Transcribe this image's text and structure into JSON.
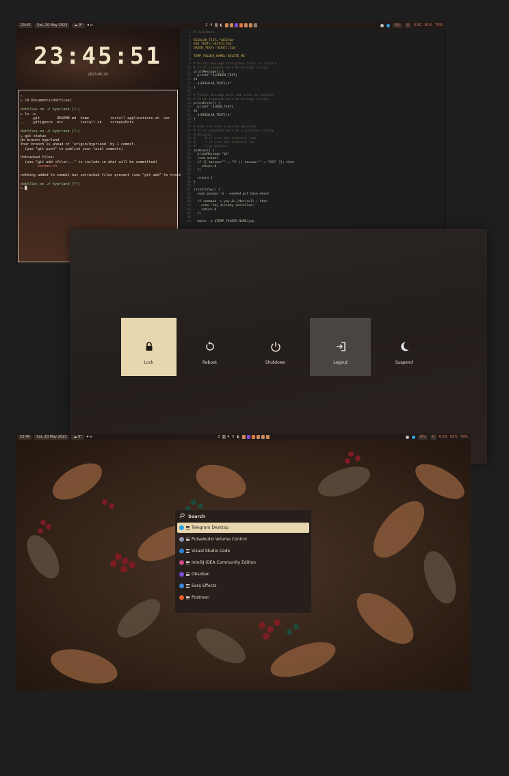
{
  "shot1": {
    "topbar": {
      "time": "23:45",
      "date": "Sat, 20 May 2023",
      "weather": "☁ 9°",
      "workspaces": [
        "2",
        "4",
        "5"
      ],
      "tray": [
        "0%",
        "0",
        "6.5G",
        "81%",
        "79%"
      ]
    },
    "clock": {
      "time": "23:45:51",
      "date": "2023-05-20"
    },
    "terminal": {
      "lines": [
        "~",
        "↳ cd Documents/dotfiles/",
        "",
        "dotfiles on ⎇ hyprland [?⇡]",
        "↳ ls -a",
        ".    .git        README.md  home          install_applications.sh  usr",
        "..   .gitignore  etc        install.sh    screenshots",
        "",
        "dotfiles on ⎇ hyprland [?⇡]",
        "↳ git status",
        "On branch hyprland",
        "Your branch is ahead of 'origin/hyprland' by 1 commit.",
        "  (use \"git push\" to publish your local commits)",
        "",
        "Untracked files:",
        "  (use \"git add <file>...\" to include in what will be committed)",
        "        screen.sh",
        "",
        "nothing added to commit but untracked files present (use \"git add\" to track)",
        "",
        "dotfiles on ⎇ hyprland [?⇡]",
        "↳ █"
      ]
    },
    "code": {
      "lines": [
        "#!/bin/bash",
        "",
        "REGULAR_TEXT='\\033[0m'",
        "RED_TEXT='\\033[1;31m'",
        "GREEN_TEXT='\\033[1;32m'",
        "",
        "TEMP_FOLDER_NAME='DELETE_ME'",
        "",
        "# Prints message with green color in console.",
        "# First argument must be message string.",
        "printMessage() {",
        "  printf \"${GREEN_TEXT}",
        "$1",
        "  ${REGULAR_TEXT}\\n\"",
        "}",
        "",
        "# Prints message with red color in console.",
        "# First argument must be message string.",
        "printError() {",
        "  printf \"${RED_TEXT}",
        "$1",
        "  ${REGULAR_TEXT}\\n\"",
        "}",
        "",
        "# Asks the user a yes/no question.",
        "# First argument must be a question string.",
        "# Returns:",
        "#   - 0 if user has selected 'yes'",
        "#   - 1 if user has selected 'no'",
        "#   - 1 by default",
        "askUser() {",
        "  printMessage \"$1\"",
        "  read answer",
        "  if [[ $answer\"\" = \"Y\" || $answer\"\" = \"YES\" ]]; then",
        "    return 0",
        "  fi",
        "",
        "  return 1",
        "}",
        "",
        "installYay() {",
        "  sudo pacman -S --needed git base-devel",
        "",
        "  if command -v yay &> /dev/null ; then",
        "    echo 'Yay already installed.'",
        "    return 0",
        "  fi",
        "",
        "  mkdir -p $TEMP_FOLDER_NAME/yay"
      ]
    }
  },
  "shot2": {
    "buttons": [
      {
        "label": "Lock",
        "icon": "lock-icon"
      },
      {
        "label": "Reboot",
        "icon": "reboot-icon"
      },
      {
        "label": "Shutdown",
        "icon": "power-icon"
      },
      {
        "label": "Logout",
        "icon": "logout-icon"
      },
      {
        "label": "Suspend",
        "icon": "moon-icon"
      }
    ],
    "colors": {
      "selected": "#e8d7ae",
      "hover": "#4a4442"
    }
  },
  "shot3": {
    "topbar": {
      "time": "23:46",
      "date": "Sat, 20 May 2023",
      "weather": "☁ 9°",
      "workspaces": [
        "2",
        "4",
        "5"
      ],
      "tray": [
        "0%",
        "0",
        "6.5G",
        "81%",
        "79%"
      ]
    },
    "launcher": {
      "search_label": "Search",
      "items": [
        {
          "name": "Telegram Desktop",
          "color": "#2aa3e0"
        },
        {
          "name": "PulseAudio Volume Control",
          "color": "#8a96b0"
        },
        {
          "name": "Visual Studio Code",
          "color": "#2c7fd1"
        },
        {
          "name": "IntelliJ IDEA Community Edition",
          "color": "#d24a8a"
        },
        {
          "name": "Obsidian",
          "color": "#7b4fd6"
        },
        {
          "name": "Easy Effects",
          "color": "#3a8ad8"
        },
        {
          "name": "Postman",
          "color": "#e8602c"
        }
      ]
    }
  }
}
